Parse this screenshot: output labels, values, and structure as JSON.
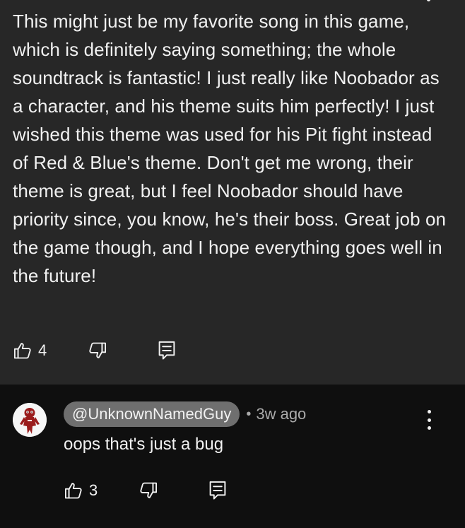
{
  "parent_comment": {
    "text": "This might just be my favorite song in this game, which is definitely saying something; the whole soundtrack is fantastic! I just really like Noobador as a character, and his theme suits him perfectly! I just wished this theme was used for his Pit fight instead of Red & Blue's theme. Don't get me wrong, their theme is great, but I feel Noobador should have priority since, you know, he's their boss. Great job on the game though, and I hope everything goes well in the future!",
    "likes": "4",
    "icons": [
      "thumbs-up-icon",
      "thumbs-down-icon",
      "reply-icon",
      "more-vert-icon"
    ]
  },
  "reply": {
    "author": "@UnknownNamedGuy",
    "separator": "•",
    "timestamp": "3w ago",
    "text": "oops that's just a bug",
    "likes": "3",
    "icons": [
      "avatar",
      "more-vert-icon",
      "thumbs-up-icon",
      "thumbs-down-icon",
      "reply-icon"
    ]
  },
  "colors": {
    "page_background": "#0f0f0f",
    "highlight_background": "#272727",
    "text": "#f1f1f1",
    "secondary_text": "#aaaaaa",
    "author_chip": "#6f6f6f"
  }
}
